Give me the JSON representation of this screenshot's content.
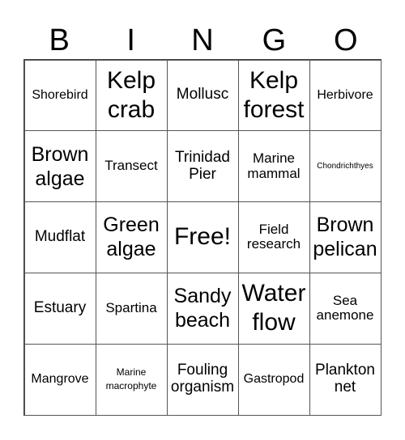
{
  "card": {
    "header": [
      "B",
      "I",
      "N",
      "G",
      "O"
    ],
    "rows": [
      [
        "Shorebird",
        "Kelp crab",
        "Mollusc",
        "Kelp forest",
        "Herbivore"
      ],
      [
        "Brown algae",
        "Transect",
        "Trinidad Pier",
        "Marine mammal",
        "Chondrichthyes"
      ],
      [
        "Mudflat",
        "Green algae",
        "Free!",
        "Field research",
        "Brown pelican"
      ],
      [
        "Estuary",
        "Spartina",
        "Sandy beach",
        "Water flow",
        "Sea anemone"
      ],
      [
        "Mangrove",
        "Marine macrophyte",
        "Fouling organism",
        "Gastropod",
        "Plankton net"
      ]
    ]
  }
}
